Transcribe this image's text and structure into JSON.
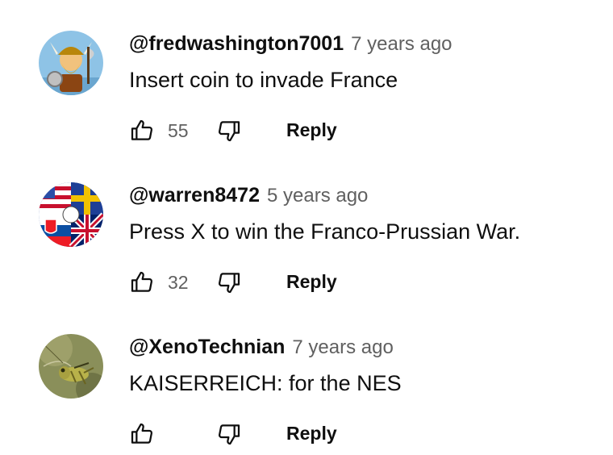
{
  "comments": [
    {
      "author": "@fredwashington7001",
      "time": "7 years ago",
      "text": "Insert coin to invade France",
      "likes": "55",
      "reply_label": "Reply",
      "avatar_icon": "viking-avatar"
    },
    {
      "author": "@warren8472",
      "time": "5 years ago",
      "text": "Press X to win the Franco-Prussian War.",
      "likes": "32",
      "reply_label": "Reply",
      "avatar_icon": "flags-avatar"
    },
    {
      "author": "@XenoTechnian",
      "time": "7 years ago",
      "text": "KAISERREICH: for the NES",
      "likes": "",
      "reply_label": "Reply",
      "avatar_icon": "grasshopper-avatar"
    }
  ],
  "colors": {
    "text_primary": "#0f0f0f",
    "text_secondary": "#606060",
    "background": "#ffffff"
  }
}
